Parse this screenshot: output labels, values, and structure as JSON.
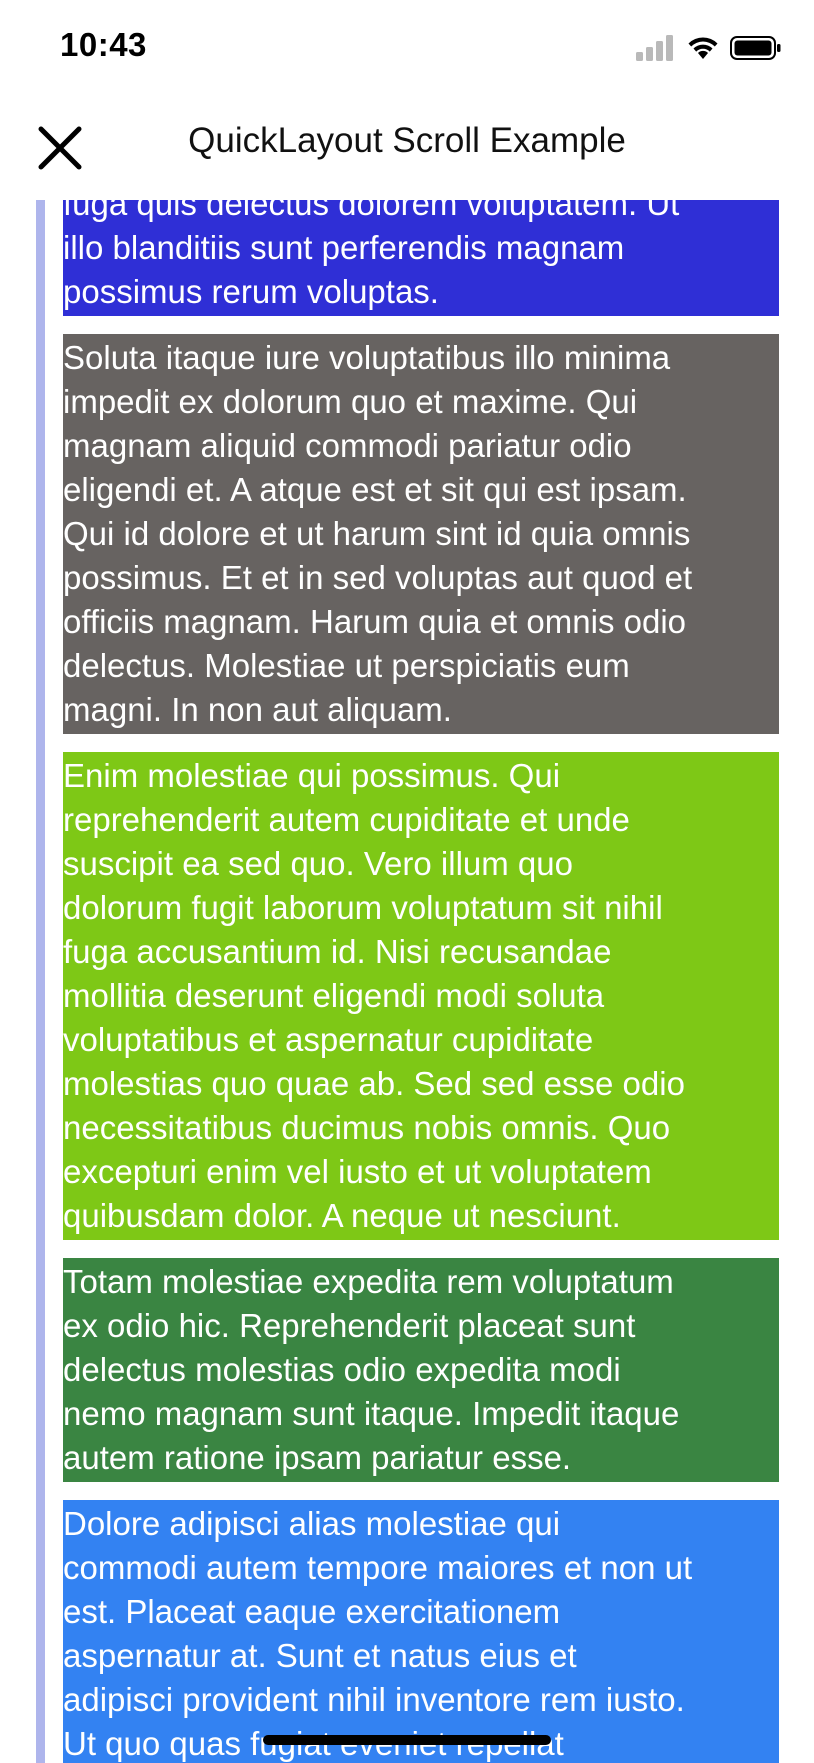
{
  "status_bar": {
    "time": "10:43",
    "icons": [
      "cellular-signal-icon",
      "wifi-icon",
      "battery-icon"
    ]
  },
  "nav": {
    "title": "QuickLayout Scroll Example",
    "close_icon": "close-icon"
  },
  "blocks": [
    {
      "text": "fuga quis delectus dolorem voluptatem. Ut\nillo blanditiis sunt perferendis magnam\npossimus rerum voluptas.",
      "color": "#2f2fd6"
    },
    {
      "text": "Soluta itaque iure voluptatibus illo minima\nimpedit ex dolorum quo et maxime. Qui\nmagnam aliquid commodi pariatur odio\neligendi et. A atque est et sit qui est ipsam.\nQui id dolore et ut harum sint id quia omnis\npossimus. Et et in sed voluptas aut quod et\nofficiis magnam. Harum quia et omnis odio\ndelectus. Molestiae ut perspiciatis eum\nmagni. In non aut aliquam.",
      "color": "#676361"
    },
    {
      "text": "Enim molestiae qui possimus. Qui\nreprehenderit autem cupiditate et unde\nsuscipit ea sed quo. Vero illum quo\ndolorum fugit laborum voluptatum sit nihil\nfuga accusantium id. Nisi recusandae\nmollitia deserunt eligendi modi soluta\nvoluptatibus et aspernatur cupiditate\nmolestias quo quae ab. Sed sed esse odio\nnecessitatibus ducimus nobis omnis. Quo\nexcepturi enim vel iusto et ut voluptatem\nquibusdam dolor. A neque ut nesciunt.",
      "color": "#7ec816"
    },
    {
      "text": "Totam molestiae expedita rem voluptatum\nex odio hic. Reprehenderit placeat sunt\ndelectus molestias odio expedita modi\nnemo magnam sunt itaque. Impedit itaque\nautem ratione ipsam pariatur esse.",
      "color": "#3a8542"
    },
    {
      "text": "Dolore adipisci alias molestiae qui\ncommodi autem tempore maiores et non ut\nest. Placeat eaque exercitationem\naspernatur at. Sunt et natus eius et\nadipisci provident nihil inventore rem iusto.\nUt quo quas fugiat eveniet repellat",
      "color": "#3382f2"
    }
  ]
}
